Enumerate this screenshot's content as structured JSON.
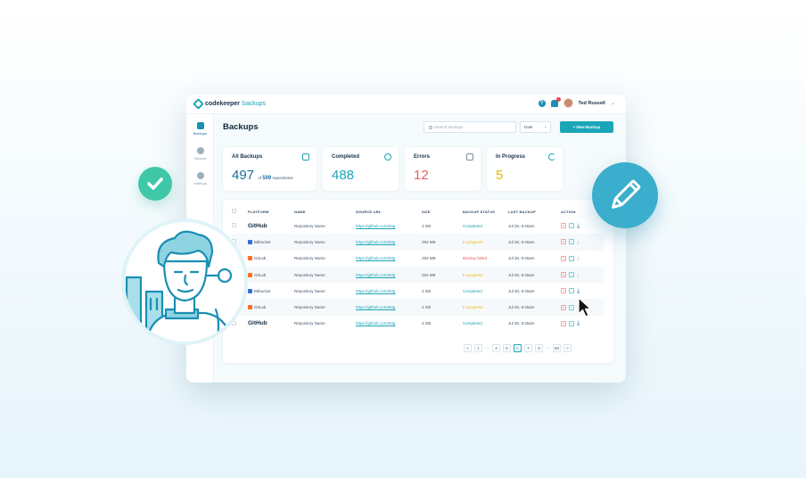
{
  "app": {
    "logo_main": "codekeeper",
    "logo_accent": "backups"
  },
  "topbar": {
    "user_name": "Ted Russell"
  },
  "sidebar": {
    "items": [
      {
        "label": "Backups",
        "icon": "file-icon",
        "active": true
      },
      {
        "label": "Support",
        "icon": "chat-icon",
        "active": false
      },
      {
        "label": "Settings",
        "icon": "gear-icon",
        "active": false
      }
    ]
  },
  "page": {
    "title": "Backups"
  },
  "search": {
    "placeholder": "Search backups"
  },
  "date_filter": {
    "value": "Date"
  },
  "new_button": {
    "label": "+ New Backup"
  },
  "cards": {
    "all": {
      "title": "All Backups",
      "value": "497",
      "of": "of",
      "total": "509",
      "suffix": "repositories"
    },
    "completed": {
      "title": "Completed",
      "value": "488"
    },
    "errors": {
      "title": "Errors",
      "value": "12"
    },
    "in_progress": {
      "title": "In Progress",
      "value": "5"
    }
  },
  "table": {
    "headers": [
      "PLATFORM",
      "NAME",
      "SOURCE URL",
      "SIZE",
      "BACKUP STATUS",
      "LAST BACKUP",
      "ACTION"
    ],
    "rows": [
      {
        "platform": "GitHub",
        "name": "Repository Name",
        "url": "https://github.com/83g",
        "size": "4 GB",
        "status": "Completed",
        "last": "Jul 30, 8:45am"
      },
      {
        "platform": "Bitbucket",
        "name": "Repository Name",
        "url": "https://github.com/83g",
        "size": "293 MB",
        "status": "In progress",
        "last": "Jul 30, 8:45am"
      },
      {
        "platform": "GitLab",
        "name": "Repository Name",
        "url": "https://github.com/83g",
        "size": "293 MB",
        "status": "Backup failed",
        "last": "Jul 30, 8:45am"
      },
      {
        "platform": "GitLab",
        "name": "Repository Name",
        "url": "https://github.com/83g",
        "size": "293 MB",
        "status": "In progress",
        "last": "Jul 30, 8:45am"
      },
      {
        "platform": "Bitbucket",
        "name": "Repository Name",
        "url": "https://github.com/83g",
        "size": "4 GB",
        "status": "Completed",
        "last": "Jul 30, 8:45am"
      },
      {
        "platform": "GitLab",
        "name": "Repository Name",
        "url": "https://github.com/83g",
        "size": "4 GB",
        "status": "In progress",
        "last": "Jul 30, 8:45am"
      },
      {
        "platform": "GitHub",
        "name": "Repository Name",
        "url": "https://github.com/83g",
        "size": "4 GB",
        "status": "Completed",
        "last": "Jul 30, 8:45am"
      }
    ]
  },
  "pagination": {
    "prev": "<",
    "first": "1",
    "dots": "···",
    "pages": [
      "4",
      "5",
      "6",
      "7",
      "8"
    ],
    "last": "50",
    "next": ">",
    "current": "6"
  },
  "colors": {
    "accent": "#1aa6b7",
    "completed": "#1aa6b7",
    "errors": "#e85d5d",
    "in_progress": "#f0b400",
    "check_bubble": "#3fc8a7",
    "pencil_bubble": "#3aaecc"
  }
}
